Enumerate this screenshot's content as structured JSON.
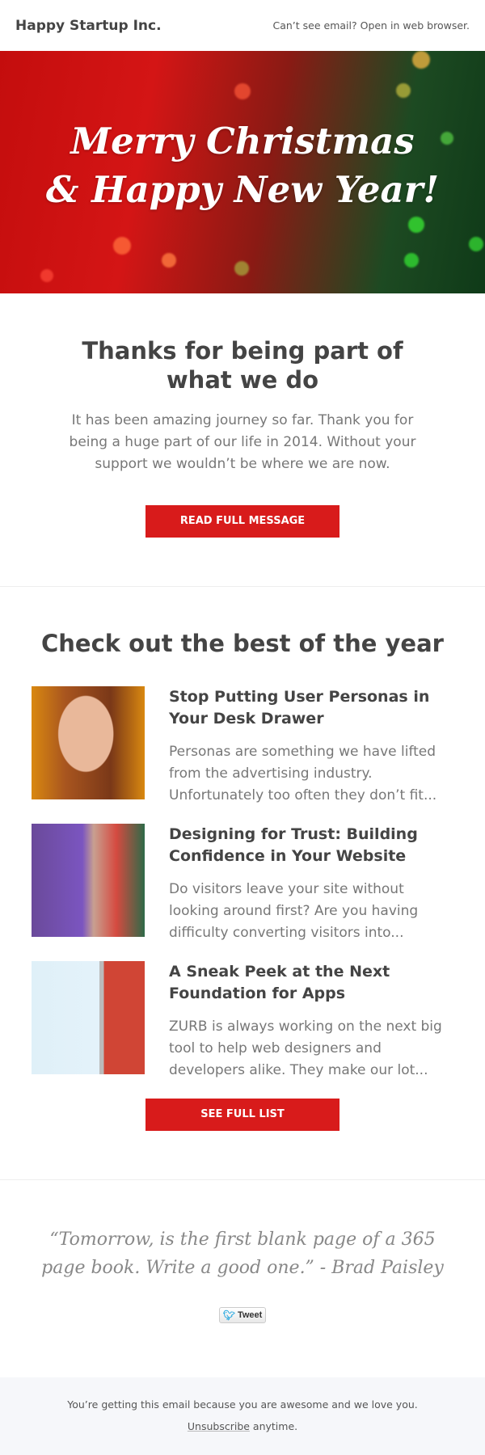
{
  "header": {
    "brand": "Happy Startup Inc.",
    "web_link": "Can’t see email? Open in web browser."
  },
  "hero": {
    "line1": "Merry Christmas",
    "line2": "& Happy New Year!"
  },
  "intro": {
    "title": "Thanks for being part of what we do",
    "body": "It has been amazing journey so far. Thank you for being a huge part of our life in 2014. Without your support we wouldn’t be where we are now.",
    "button": "READ FULL MESSAGE"
  },
  "best": {
    "title": "Check out the best of the year",
    "articles": [
      {
        "title": "Stop Putting User Personas in Your Desk Drawer",
        "desc": "Personas are something we have lifted from the advertising industry. Unfortunately too often they don’t fit..."
      },
      {
        "title": "Designing for Trust: Building Confidence in Your Website",
        "desc": "Do visitors leave your site without looking around first? Are you having difficulty converting visitors into..."
      },
      {
        "title": "A Sneak Peek at the Next Foundation for Apps",
        "desc": "ZURB is always working on the next big tool to help web designers and developers alike. They make our lot..."
      }
    ],
    "button": "SEE FULL LIST"
  },
  "quote": {
    "text": "“Tomorrow, is the first blank page of a 365 page book. Write a good one.” - Brad Paisley",
    "tweet": "Tweet"
  },
  "footer": {
    "line1": "You’re getting this email because you are awesome and we love you.",
    "unsubscribe": "Unsubscribe",
    "anytime": " anytime."
  },
  "colors": {
    "accent": "#d81b1b",
    "footer_bg": "#f6f7fa"
  }
}
